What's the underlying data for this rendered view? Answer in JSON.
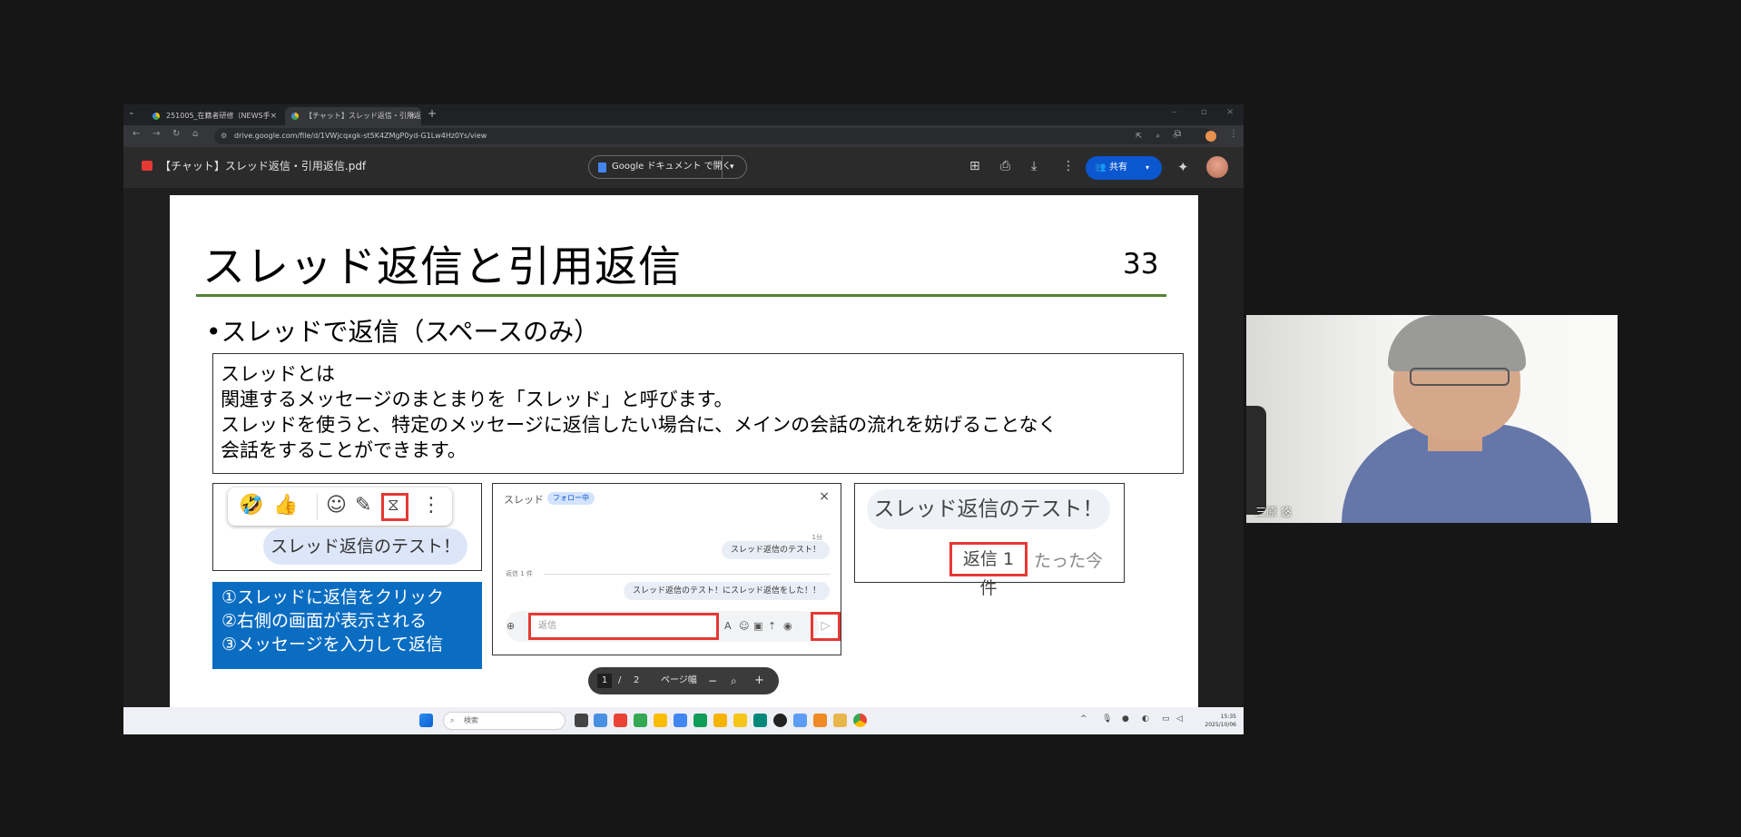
{
  "browser": {
    "tabs": [
      {
        "label": "251005_在籍者研修（NEWS手"
      },
      {
        "label": "【チャット】スレッド返信・引用返信"
      }
    ],
    "url": "drive.google.com/file/d/1VWjcqxgk-st5K4ZMgP0yd-G1Lw4Hz0Ys/view"
  },
  "viewer": {
    "doc_title": "【チャット】スレッド返信・引用返信.pdf",
    "open_with_label": "Google ドキュメント で開く",
    "share_label": "共有"
  },
  "slide": {
    "title": "スレッド返信と引用返信",
    "page_number": "33",
    "bullet": "•スレッドで返信（スペースのみ）",
    "definition_lines": [
      "スレッドとは",
      "関連するメッセージのまとまりを「スレッド」と呼びます。",
      "スレッドを使うと、特定のメッセージに返信したい場合に、メインの会話の流れを妨げることなく",
      "会話をすることができます。"
    ],
    "mock1_bubble": "スレッド返信のテスト！",
    "steps": [
      "①スレッドに返信をクリック",
      "②右側の画面が表示される",
      "③メッセージを入力して返信"
    ],
    "mock2": {
      "header": "スレッド",
      "follow_chip": "フォロー中",
      "time_label": "1分",
      "message1": "スレッド返信のテスト！",
      "replies_label": "返信 1 件",
      "message2": "スレッド返信のテスト！にスレッド返信をした！！",
      "input_placeholder": "返信"
    },
    "mock3": {
      "bubble": "スレッド返信のテスト！",
      "reply_count": "返信 1 件",
      "ago": "たった今"
    }
  },
  "page_controls": {
    "current": "1",
    "separator": "/",
    "total": "2",
    "fit_label": "ページ幅"
  },
  "taskbar": {
    "search_placeholder": "検索",
    "time": "15:35",
    "date": "2025/10/06"
  },
  "camera": {
    "participant_name": "三原 悠"
  }
}
